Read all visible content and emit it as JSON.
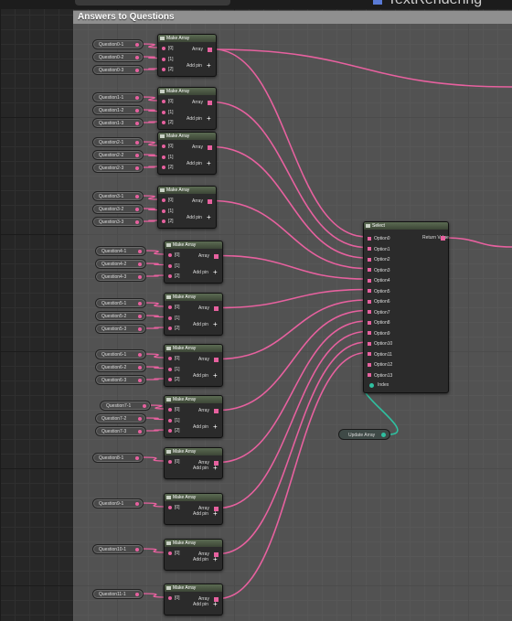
{
  "window": {
    "tab_title": "TextRendering"
  },
  "comment_box": {
    "title": "Answers to Questions"
  },
  "make_array_nodes": [
    {
      "title": "Make Array",
      "inputs": [
        "Question0-1",
        "Question0-2",
        "Question0-3"
      ],
      "pins": [
        "[0]",
        "[1]",
        "[2]"
      ],
      "output": "Array",
      "add_pin": "Add pin"
    },
    {
      "title": "Make Array",
      "inputs": [
        "Question1-1",
        "Question1-2",
        "Question1-3"
      ],
      "pins": [
        "[0]",
        "[1]",
        "[2]"
      ],
      "output": "Array",
      "add_pin": "Add pin"
    },
    {
      "title": "Make Array",
      "inputs": [
        "Question2-1",
        "Question2-2",
        "Question2-3"
      ],
      "pins": [
        "[0]",
        "[1]",
        "[2]"
      ],
      "output": "Array",
      "add_pin": "Add pin"
    },
    {
      "title": "Make Array",
      "inputs": [
        "Question3-1",
        "Question3-2",
        "Question3-3"
      ],
      "pins": [
        "[0]",
        "[1]",
        "[2]"
      ],
      "output": "Array",
      "add_pin": "Add pin"
    },
    {
      "title": "Make Array",
      "inputs": [
        "Question4-1",
        "Question4-2",
        "Question4-3"
      ],
      "pins": [
        "[0]",
        "[1]",
        "[2]"
      ],
      "output": "Array",
      "add_pin": "Add pin"
    },
    {
      "title": "Make Array",
      "inputs": [
        "Question5-1",
        "Question5-2",
        "Question5-3"
      ],
      "pins": [
        "[0]",
        "[1]",
        "[2]"
      ],
      "output": "Array",
      "add_pin": "Add pin"
    },
    {
      "title": "Make Array",
      "inputs": [
        "Question6-1",
        "Question6-2",
        "Question6-3"
      ],
      "pins": [
        "[0]",
        "[1]",
        "[2]"
      ],
      "output": "Array",
      "add_pin": "Add pin"
    },
    {
      "title": "Make Array",
      "inputs": [
        "Question7-1",
        "Question7-2",
        "Question7-3"
      ],
      "pins": [
        "[0]",
        "[1]",
        "[2]"
      ],
      "output": "Array",
      "add_pin": "Add pin"
    },
    {
      "title": "Make Array",
      "inputs": [
        "Question8-1"
      ],
      "pins": [
        "[0]"
      ],
      "output": "Array",
      "add_pin": "Add pin"
    },
    {
      "title": "Make Array",
      "inputs": [
        "Question9-1"
      ],
      "pins": [
        "[0]"
      ],
      "output": "Array",
      "add_pin": "Add pin"
    },
    {
      "title": "Make Array",
      "inputs": [
        "Question10-1"
      ],
      "pins": [
        "[0]"
      ],
      "output": "Array",
      "add_pin": "Add pin"
    },
    {
      "title": "Make Array",
      "inputs": [
        "Question11-1"
      ],
      "pins": [
        "[0]"
      ],
      "output": "Array",
      "add_pin": "Add pin"
    }
  ],
  "select_node": {
    "title": "Select",
    "options": [
      "Option0",
      "Option1",
      "Option2",
      "Option3",
      "Option4",
      "Option5",
      "Option6",
      "Option7",
      "Option8",
      "Option9",
      "Option10",
      "Option11",
      "Option12",
      "Option13"
    ],
    "index_label": "Index",
    "return_label": "Return Value"
  },
  "update_node": {
    "label": "Update Array"
  },
  "colors": {
    "wire_array": "#e7619f",
    "wire_int": "#2fc0a0",
    "node_header": "#5b6b52",
    "comment": "#8f8f8f"
  }
}
